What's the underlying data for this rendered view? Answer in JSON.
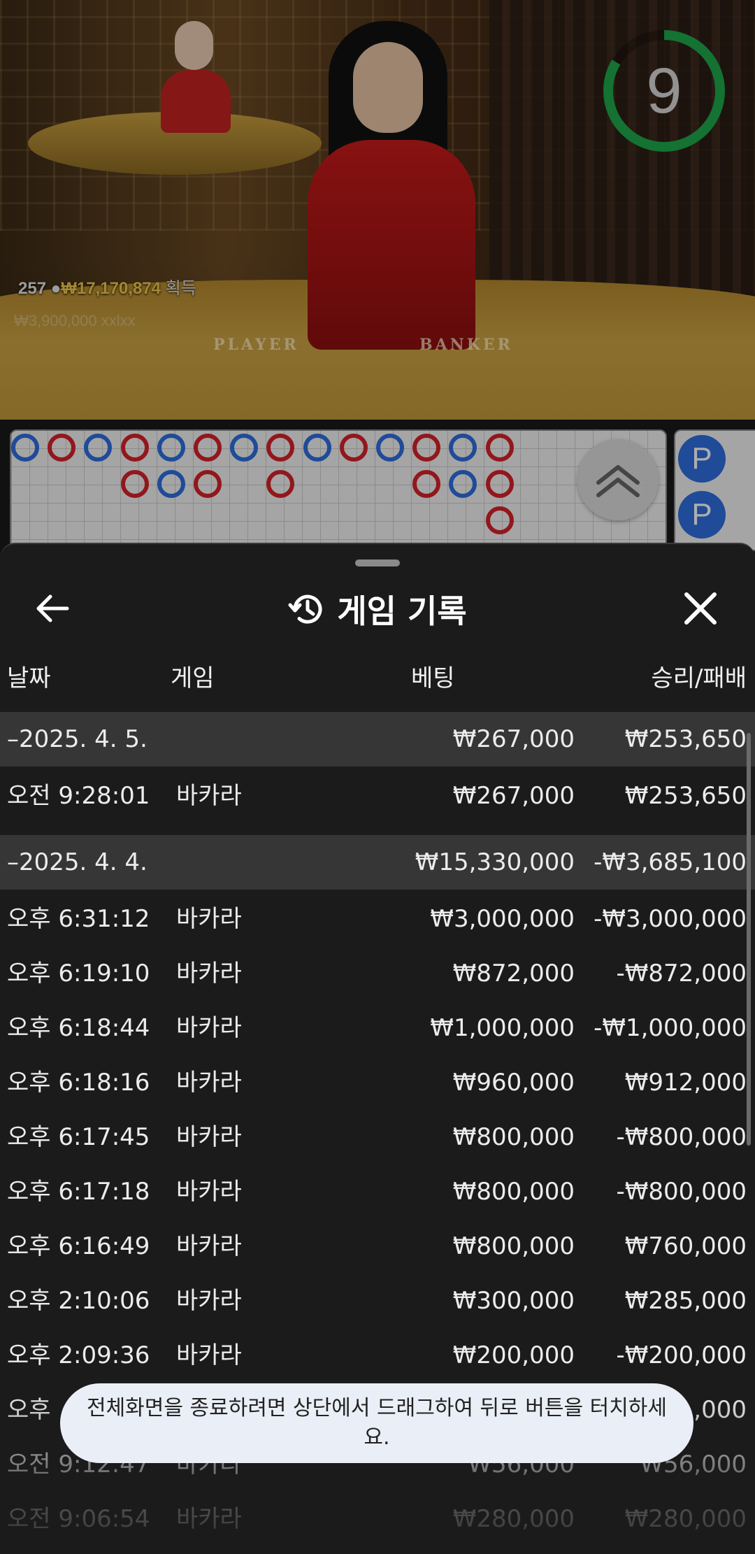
{
  "stream": {
    "countdown": "9",
    "player_count": "257",
    "win_amount": "₩17,170,874",
    "win_suffix": "획득",
    "overlay_text": "₩3,900,000  xxlxx",
    "table_labels": {
      "player": "PLAYER",
      "banker": "BANKER"
    },
    "timer_color": "#1ea84a"
  },
  "board": {
    "colors": {
      "player": "#2f6fe0",
      "banker": "#d8232a"
    },
    "columns": [
      [
        "P"
      ],
      [
        "B"
      ],
      [
        "P"
      ],
      [
        "B",
        "B"
      ],
      [
        "P",
        "P"
      ],
      [
        "B",
        "B"
      ],
      [
        "P"
      ],
      [
        "B",
        "B"
      ],
      [
        "P"
      ],
      [
        "B"
      ],
      [
        "P"
      ],
      [
        "B",
        "B"
      ],
      [
        "P",
        "P"
      ],
      [
        "B",
        "B",
        "B"
      ]
    ],
    "side_chips": [
      "P",
      "P"
    ]
  },
  "sheet": {
    "title": "게임 기록",
    "history_icon": "history-icon",
    "back_icon": "arrow-left-icon",
    "close_icon": "close-icon",
    "columns": {
      "date": "날짜",
      "game": "게임",
      "bet": "베팅",
      "result": "승리/패배"
    },
    "groups": [
      {
        "date": "–2025. 4. 5.",
        "bet": "₩267,000",
        "result": "₩253,650",
        "rows": [
          {
            "time": "오전 9:28:01",
            "game": "바카라",
            "bet": "₩267,000",
            "result": "₩253,650"
          }
        ]
      },
      {
        "date": "–2025. 4. 4.",
        "bet": "₩15,330,000",
        "result": "-₩3,685,100",
        "rows": [
          {
            "time": "오후 6:31:12",
            "game": "바카라",
            "bet": "₩3,000,000",
            "result": "-₩3,000,000"
          },
          {
            "time": "오후 6:19:10",
            "game": "바카라",
            "bet": "₩872,000",
            "result": "-₩872,000"
          },
          {
            "time": "오후 6:18:44",
            "game": "바카라",
            "bet": "₩1,000,000",
            "result": "-₩1,000,000"
          },
          {
            "time": "오후 6:18:16",
            "game": "바카라",
            "bet": "₩960,000",
            "result": "₩912,000"
          },
          {
            "time": "오후 6:17:45",
            "game": "바카라",
            "bet": "₩800,000",
            "result": "-₩800,000"
          },
          {
            "time": "오후 6:17:18",
            "game": "바카라",
            "bet": "₩800,000",
            "result": "-₩800,000"
          },
          {
            "time": "오후 6:16:49",
            "game": "바카라",
            "bet": "₩800,000",
            "result": "₩760,000"
          },
          {
            "time": "오후 2:10:06",
            "game": "바카라",
            "bet": "₩300,000",
            "result": "₩285,000"
          },
          {
            "time": "오후 2:09:36",
            "game": "바카라",
            "bet": "₩200,000",
            "result": "-₩200,000"
          },
          {
            "time": "오후 ",
            "game": "",
            "bet": "",
            "result": ",000"
          },
          {
            "time": "오전 9:12:47",
            "game": "바카라",
            "bet": "₩56,000",
            "result": "₩56,000"
          },
          {
            "time": "오전 9:06:54",
            "game": "바카라",
            "bet": "₩280,000",
            "result": "₩280,000"
          }
        ]
      }
    ]
  },
  "toast": {
    "message": "전체화면을 종료하려면 상단에서 드래그하여 뒤로 버튼을 터치하세요."
  }
}
